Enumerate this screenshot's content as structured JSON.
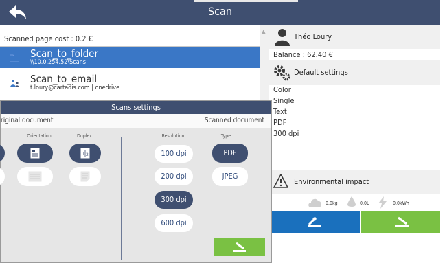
{
  "window": {
    "title": "Scan"
  },
  "left": {
    "cost_text": "Scanned page cost : 0.2 €",
    "destinations": [
      {
        "name": "Scan_to_folder",
        "sub": "\\\\10.0.254.52\\Scans",
        "selected": true,
        "icon": "folder-icon"
      },
      {
        "name": "Scan_to_email",
        "sub": "t.loury@cartadis.com | onedrive",
        "selected": false,
        "icon": "users-icon"
      }
    ]
  },
  "right": {
    "user_name": "Théo Loury",
    "balance": "Balance : 62.40 €",
    "default_settings_label": "Default settings",
    "settings": [
      "Color",
      "Single",
      "Text",
      "PDF",
      "300 dpi"
    ],
    "env_label": "Environmental impact",
    "env": {
      "co2": "0.0kg",
      "water": "0.0L",
      "energy": "0.0kWh"
    }
  },
  "dialog": {
    "title": "Scans settings",
    "original_header": "riginal document",
    "scanned_header": "Scanned document",
    "orientation_label": "Orientation",
    "duplex_label": "Duplex",
    "resolution_label": "Resolution",
    "type_label": "Type",
    "resolutions": [
      {
        "label": "100 dpi",
        "selected": false
      },
      {
        "label": "200 dpi",
        "selected": false
      },
      {
        "label": "300 dpi",
        "selected": true
      },
      {
        "label": "600 dpi",
        "selected": false
      }
    ],
    "types": [
      {
        "label": "PDF",
        "selected": true
      },
      {
        "label": "JPEG",
        "selected": false
      }
    ]
  },
  "colors": {
    "header": "#3f4f70",
    "selected_row": "#3a77c6",
    "blue_button": "#1a70bd",
    "green_button": "#7ac143"
  }
}
